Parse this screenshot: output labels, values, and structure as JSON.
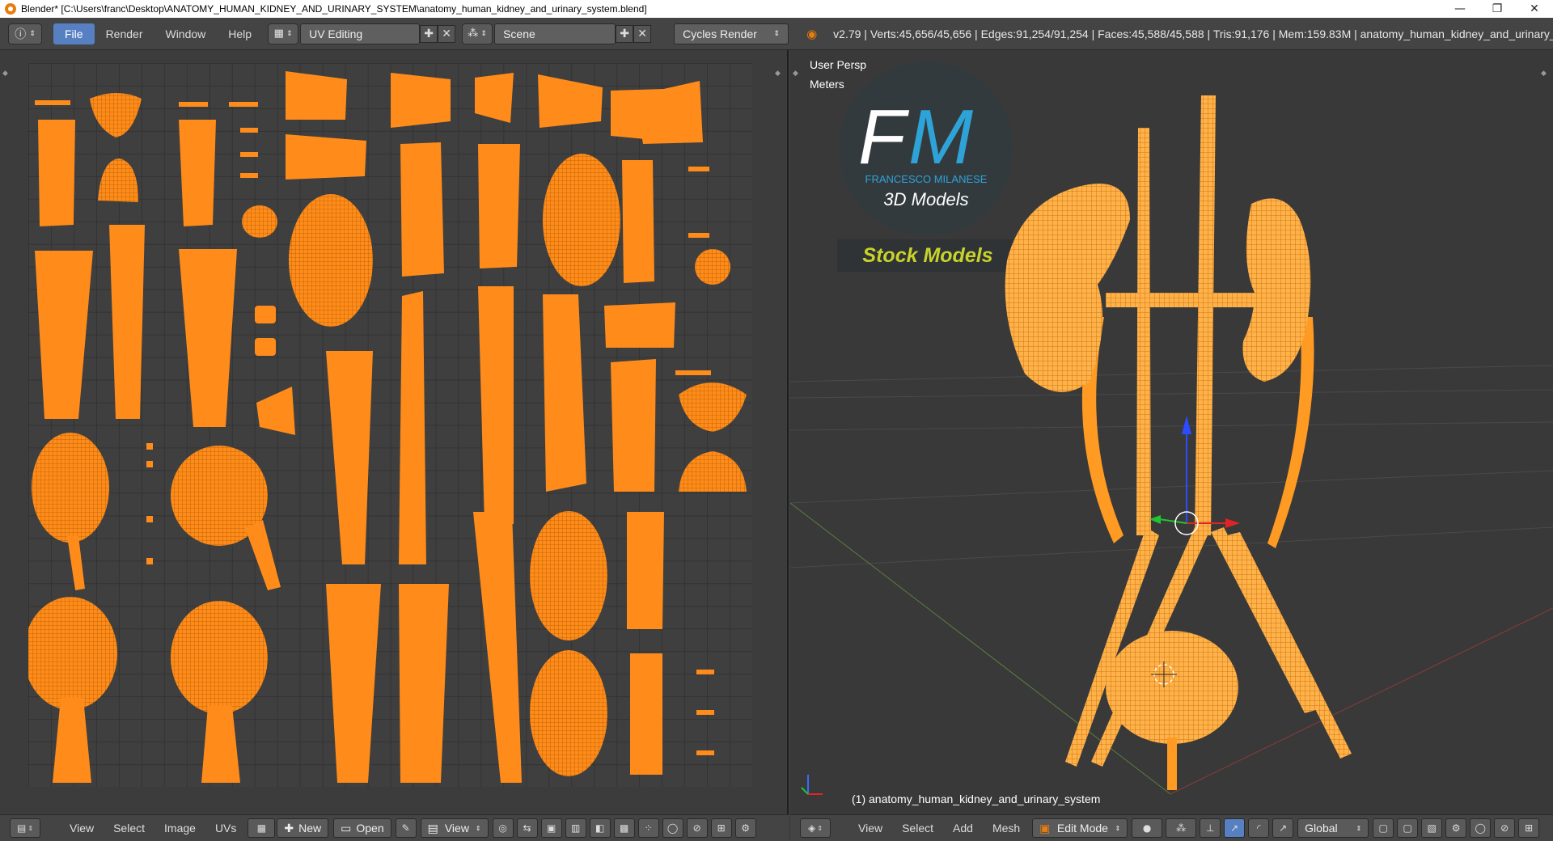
{
  "window": {
    "title": "Blender* [C:\\Users\\franc\\Desktop\\ANATOMY_HUMAN_KIDNEY_AND_URINARY_SYSTEM\\anatomy_human_kidney_and_urinary_system.blend]",
    "minimize": "—",
    "maximize": "❐",
    "close": "✕"
  },
  "info_header": {
    "menus": [
      "File",
      "Render",
      "Window",
      "Help"
    ],
    "active_menu": "File",
    "screen_layout": "UV Editing",
    "scene": "Scene",
    "render_engine": "Cycles Render",
    "stats": "v2.79 | Verts:45,656/45,656 | Edges:91,254/91,254 | Faces:45,588/45,588 | Tris:91,176 | Mem:159.83M | anatomy_human_kidney_and_urinary_system"
  },
  "viewport": {
    "view_name": "User Persp",
    "units": "Meters",
    "object_label": "(1) anatomy_human_kidney_and_urinary_system",
    "logo_letters_f": "F",
    "logo_letters_m": "M",
    "logo_author": "FRANCESCO MILANESE",
    "logo_subtitle": "3D Models",
    "banner": "Stock Models"
  },
  "uv_footer": {
    "menus": [
      "View",
      "Select",
      "Image",
      "UVs"
    ],
    "new_label": "New",
    "open_label": "Open",
    "view_label": "View"
  },
  "vp_footer": {
    "menus": [
      "View",
      "Select",
      "Add",
      "Mesh"
    ],
    "mode": "Edit Mode",
    "orientation": "Global"
  },
  "colors": {
    "mesh": "#ff8c1a",
    "header": "#444444",
    "accent": "#5680c2"
  }
}
